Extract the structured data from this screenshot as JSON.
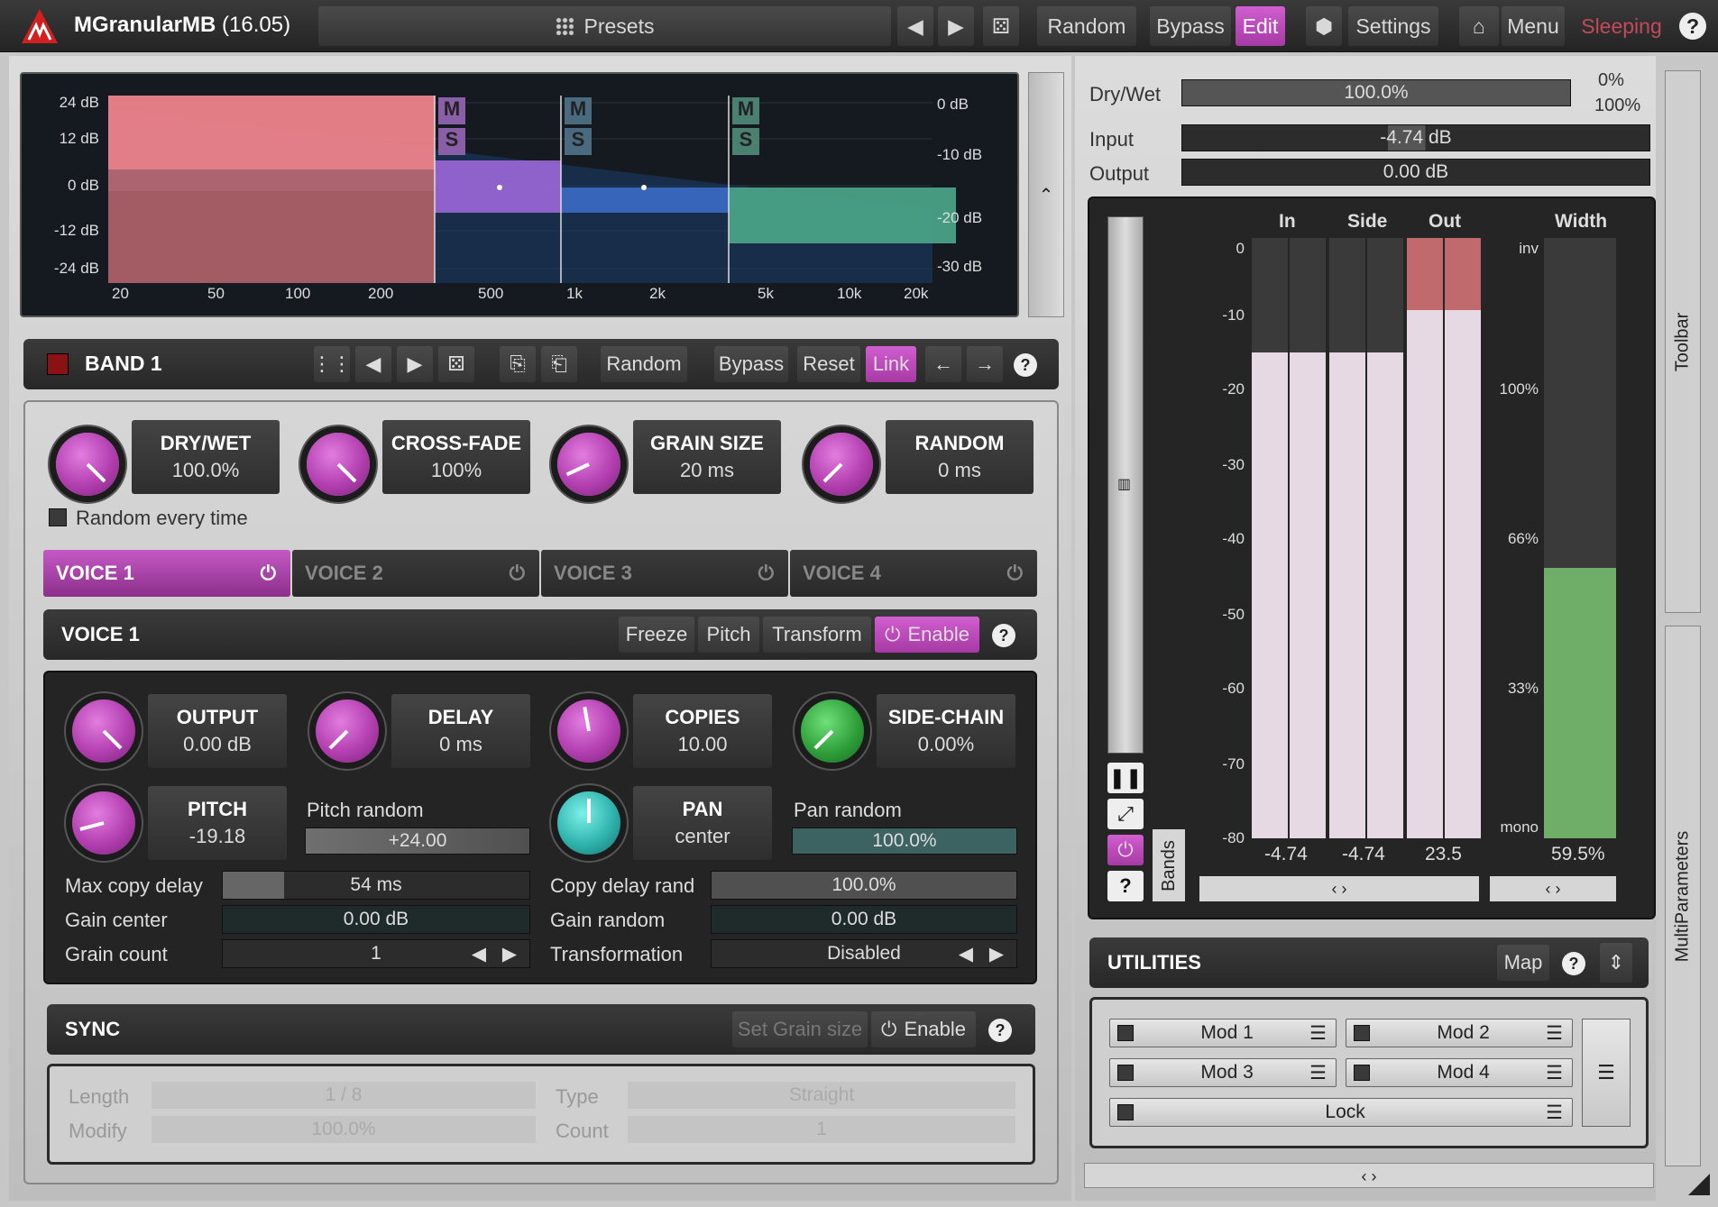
{
  "app": {
    "name": "MGranularMB",
    "version": "(16.05)"
  },
  "topbar": {
    "presets": "Presets",
    "random": "Random",
    "bypass": "Bypass",
    "edit": "Edit",
    "settings": "Settings",
    "menu": "Menu",
    "sleeping": "Sleeping"
  },
  "eq": {
    "left_scale": [
      "24 dB",
      "12 dB",
      "0 dB",
      "-12 dB",
      "-24 dB"
    ],
    "right_scale": [
      "0 dB",
      "-10 dB",
      "-20 dB",
      "-30 dB"
    ],
    "freq": [
      "20",
      "50",
      "100",
      "200",
      "500",
      "1k",
      "2k",
      "5k",
      "10k",
      "20k"
    ],
    "band_marks": [
      "M",
      "S"
    ]
  },
  "mix": {
    "drywet_label": "Dry/Wet",
    "drywet": "100.0%",
    "pct0": "0%",
    "pct100": "100%",
    "input_label": "Input",
    "input": "-4.74 dB",
    "output_label": "Output",
    "output": "0.00 dB"
  },
  "band": {
    "title": "BAND 1",
    "random": "Random",
    "bypass": "Bypass",
    "reset": "Reset",
    "link": "Link"
  },
  "knobs": [
    {
      "t": "DRY/WET",
      "v": "100.0%"
    },
    {
      "t": "CROSS-FADE",
      "v": "100%"
    },
    {
      "t": "GRAIN SIZE",
      "v": "20 ms"
    },
    {
      "t": "RANDOM",
      "v": "0 ms"
    }
  ],
  "random_every_time": "Random every time",
  "voices": [
    "VOICE 1",
    "VOICE 2",
    "VOICE 3",
    "VOICE 4"
  ],
  "voice": {
    "title": "VOICE 1",
    "freeze": "Freeze",
    "pitch": "Pitch",
    "transform": "Transform",
    "enable": "Enable"
  },
  "vknobs": [
    {
      "t": "OUTPUT",
      "v": "0.00 dB"
    },
    {
      "t": "DELAY",
      "v": "0 ms"
    },
    {
      "t": "COPIES",
      "v": "10.00"
    },
    {
      "t": "SIDE-CHAIN",
      "v": "0.00%"
    },
    {
      "t": "PITCH",
      "v": "-19.18"
    },
    {
      "t": "PAN",
      "v": "center"
    }
  ],
  "pitch_random": {
    "label": "Pitch random",
    "value": "+24.00"
  },
  "pan_random": {
    "label": "Pan random",
    "value": "100.0%"
  },
  "params": {
    "max_copy_delay": {
      "label": "Max copy delay",
      "value": "54 ms"
    },
    "copy_delay_rand": {
      "label": "Copy delay rand",
      "value": "100.0%"
    },
    "gain_center": {
      "label": "Gain center",
      "value": "0.00 dB"
    },
    "gain_random": {
      "label": "Gain random",
      "value": "0.00 dB"
    },
    "grain_count": {
      "label": "Grain count",
      "value": "1"
    },
    "transformation": {
      "label": "Transformation",
      "value": "Disabled"
    }
  },
  "sync": {
    "title": "SYNC",
    "set_grain": "Set Grain size",
    "enable": "Enable",
    "length_label": "Length",
    "length": "1 / 8",
    "type_label": "Type",
    "type": "Straight",
    "modify_label": "Modify",
    "modify": "100.0%",
    "count_label": "Count",
    "count": "1"
  },
  "meters": {
    "in": "In",
    "side": "Side",
    "out": "Out",
    "width": "Width",
    "scale": [
      "0",
      "-10",
      "-20",
      "-30",
      "-40",
      "-50",
      "-60",
      "-70",
      "-80"
    ],
    "wscale": [
      "inv",
      "100%",
      "66%",
      "33%",
      "mono"
    ],
    "in_val": "-4.74",
    "side_val": "-4.74",
    "out_val": "23.5",
    "width_val": "59.5%",
    "bands": "Bands"
  },
  "utilities": {
    "title": "UTILITIES",
    "map": "Map",
    "mods": [
      "Mod 1",
      "Mod 2",
      "Mod 3",
      "Mod 4"
    ],
    "lock": "Lock"
  },
  "side_tabs": {
    "toolbar": "Toolbar",
    "multiparam": "MultiParameters"
  }
}
